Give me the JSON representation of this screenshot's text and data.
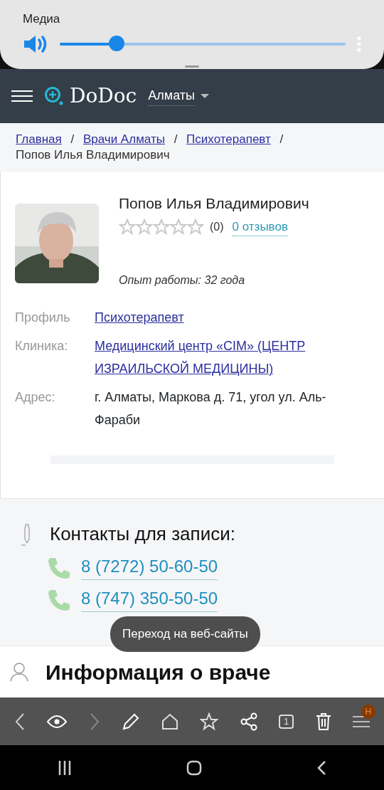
{
  "media_panel": {
    "title": "Медиа",
    "volume": {
      "level": 0.2
    }
  },
  "navbar": {
    "logo": "DoDoc",
    "city": "Алматы"
  },
  "breadcrumb": [
    {
      "label": "Главная",
      "kind": "link"
    },
    {
      "label": "/",
      "kind": "separator"
    },
    {
      "label": "Врачи Алматы",
      "kind": "link"
    },
    {
      "label": "/",
      "kind": "separator"
    },
    {
      "label": "Психотерапевт",
      "kind": "link"
    },
    {
      "label": "/",
      "kind": "separator"
    },
    {
      "label": "Попов Илья Владимирович",
      "kind": "current"
    }
  ],
  "doctor": {
    "name": "Попов Илья Владимирович",
    "stars": 0,
    "rating_count": "(0)",
    "reviews_link": "0 отзывов",
    "experience": "Опыт работы: 32 года",
    "details": [
      {
        "label": "Профиль",
        "value": "Психотерапевт",
        "kind": "link"
      },
      {
        "label": "Клиника:",
        "value": "Медицинский центр «CIM» (ЦЕНТР ИЗРАИЛЬСКОЙ МЕДИЦИНЫ)",
        "kind": "link"
      },
      {
        "label": "Адрес:",
        "value": "г. Алматы, Маркова д. 71, угол ул. Аль-Фараби",
        "kind": "text"
      }
    ]
  },
  "contacts": {
    "title": "Контакты для записи:",
    "phones": [
      "8 (7272) 50-60-50",
      "8 (747) 350-50-50"
    ]
  },
  "info_heading": "Информация о враче",
  "toast": "Переход на веб-сайты",
  "browser_toolbar": {
    "tab_count": "1",
    "profile_badge": "Н"
  }
}
